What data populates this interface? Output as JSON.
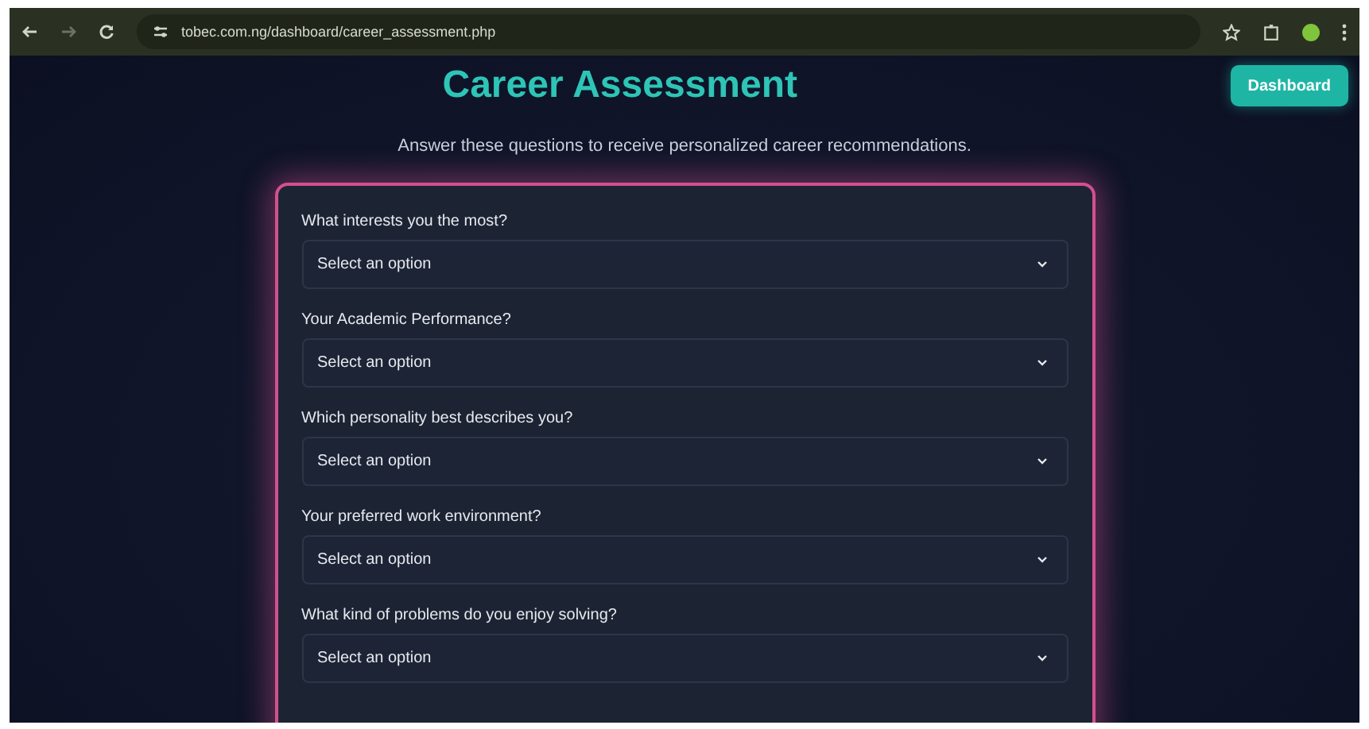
{
  "browser": {
    "url": "tobec.com.ng/dashboard/career_assessment.php"
  },
  "header": {
    "title": "Career Assessment",
    "dashboard_button": "Dashboard"
  },
  "subtitle": "Answer these questions to receive personalized career recommendations.",
  "questions": [
    {
      "label": "What interests you the most?",
      "placeholder": "Select an option"
    },
    {
      "label": "Your Academic Performance?",
      "placeholder": "Select an option"
    },
    {
      "label": "Which personality best describes you?",
      "placeholder": "Select an option"
    },
    {
      "label": "Your preferred work environment?",
      "placeholder": "Select an option"
    },
    {
      "label": "What kind of problems do you enjoy solving?",
      "placeholder": "Select an option"
    }
  ]
}
